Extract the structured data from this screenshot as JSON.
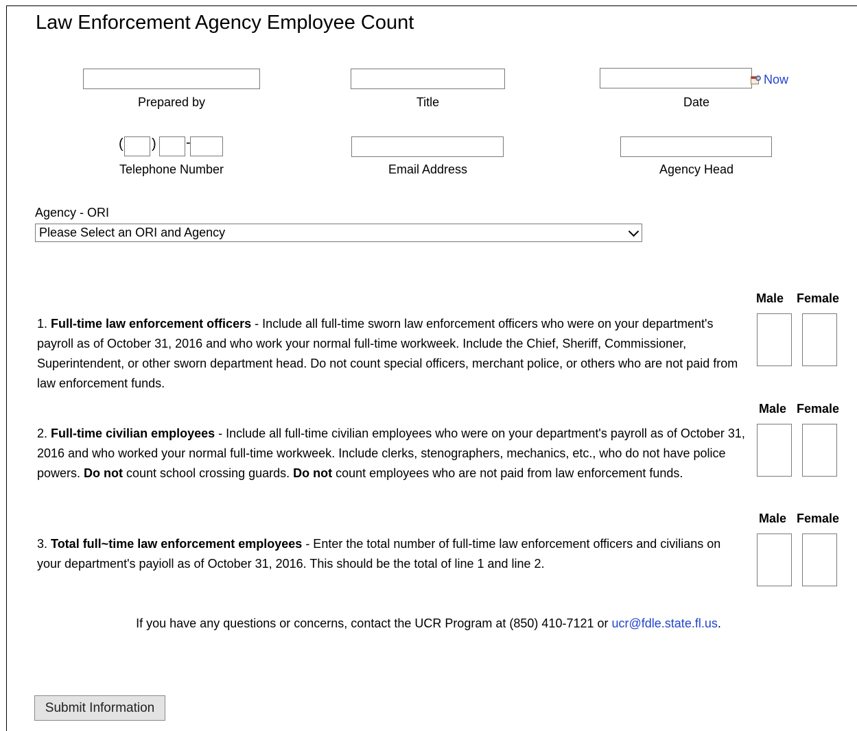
{
  "page_title": "Law Enforcement Agency Employee Count",
  "fields": {
    "prepared_by": {
      "label": "Prepared by",
      "value": ""
    },
    "title": {
      "label": "Title",
      "value": ""
    },
    "date": {
      "label": "Date",
      "value": "",
      "now_link": "Now"
    },
    "telephone": {
      "label": "Telephone Number",
      "area": "",
      "prefix": "",
      "line": "",
      "open_paren": "(",
      "close_paren": ")",
      "dash": "-"
    },
    "email": {
      "label": "Email Address",
      "value": ""
    },
    "agency_head": {
      "label": "Agency Head",
      "value": ""
    }
  },
  "agency_select": {
    "label": "Agency - ORI",
    "selected": "Please Select an ORI and Agency"
  },
  "columns": {
    "male": "Male",
    "female": "Female"
  },
  "questions": [
    {
      "number": "1.",
      "bold": "Full-time law enforcement officers",
      "text": " - Include all full-time sworn law enforcement officers who were on your department's payroll as of October 31, 2016 and who work your normal full-time workweek. Include the Chief, Sheriff, Commissioner, Superintendent, or other sworn department head. Do not count special officers, merchant police, or others who are not paid from law enforcement funds.",
      "male": "",
      "female": ""
    },
    {
      "number": "2.",
      "bold": "Full-time civilian employees",
      "text_a": " - Include all full-time civilian employees who were on your department's payroll as of October 31, 2016 and who worked your normal full-time workweek. Include clerks, stenographers, mechanics, etc., who do not have police powers. ",
      "bold_b": "Do not",
      "text_b": " count school crossing guards. ",
      "bold_c": "Do not",
      "text_c": " count employees who are not paid from law enforcement funds.",
      "male": "",
      "female": ""
    },
    {
      "number": "3.",
      "bold": "Total full~time law enforcement employees",
      "text": " - Enter the total number of full-time law enforcement officers and civilians on your department's payioll as of October 31, 2016. This should be the total of line 1 and line 2.",
      "male": "",
      "female": ""
    }
  ],
  "footer": {
    "text": "If you have any questions or concerns, contact the UCR Program at (850) 410-7121 or ",
    "email_link": "ucr@fdle.state.fl.us",
    "end": "."
  },
  "submit_label": "Submit Information"
}
